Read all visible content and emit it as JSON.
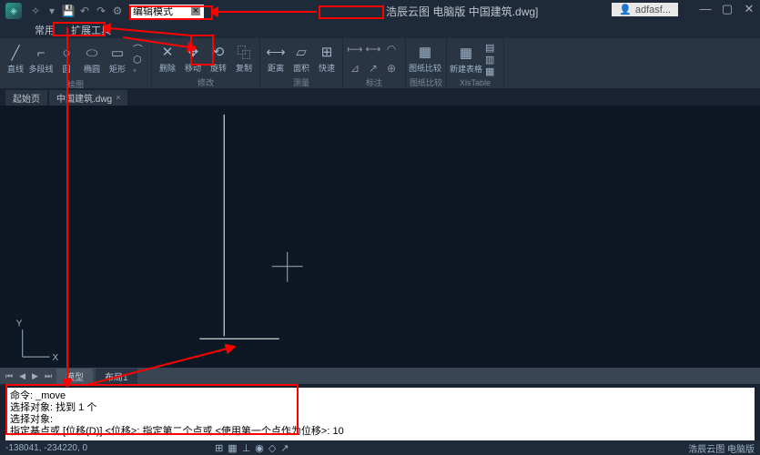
{
  "title": {
    "app": "浩辰云图 电脑版",
    "file": "中国建筑.dwg]"
  },
  "mode_box": "编辑模式",
  "user": "adfasf...",
  "menu": [
    "常用",
    "扩展工具"
  ],
  "ribbon": {
    "g1": {
      "label": "绘图",
      "btns": [
        {
          "name": "line",
          "lbl": "直线",
          "ico": "╱"
        },
        {
          "name": "polyline",
          "lbl": "多段线",
          "ico": "⌐"
        },
        {
          "name": "circle",
          "lbl": "圆",
          "ico": "○"
        },
        {
          "name": "ellipse",
          "lbl": "椭圆",
          "ico": "⬭"
        },
        {
          "name": "rect",
          "lbl": "矩形",
          "ico": "▭"
        }
      ]
    },
    "g2": {
      "label": "修改",
      "btns": [
        {
          "name": "delete",
          "lbl": "删除",
          "ico": "✕"
        },
        {
          "name": "move",
          "lbl": "移动",
          "ico": "✥"
        },
        {
          "name": "rotate",
          "lbl": "旋转",
          "ico": "⟲"
        },
        {
          "name": "copy",
          "lbl": "复制",
          "ico": "⿻"
        }
      ]
    },
    "g3": {
      "label": "测量",
      "btns": [
        {
          "name": "dist",
          "lbl": "距离",
          "ico": "⟷"
        },
        {
          "name": "area",
          "lbl": "面积",
          "ico": "▱"
        },
        {
          "name": "quick",
          "lbl": "快速",
          "ico": "⊞"
        }
      ]
    },
    "g4": {
      "label": "标注",
      "btns": [
        {
          "name": "dim1",
          "lbl": "",
          "ico": "⟼"
        },
        {
          "name": "dim2",
          "lbl": "",
          "ico": "⟷"
        },
        {
          "name": "dim3",
          "lbl": "",
          "ico": "◠"
        },
        {
          "name": "dim4",
          "lbl": "",
          "ico": "⊿"
        },
        {
          "name": "dim5",
          "lbl": "",
          "ico": "↗"
        },
        {
          "name": "dim6",
          "lbl": "",
          "ico": "⊕"
        }
      ]
    },
    "g5": {
      "label": "图纸比较",
      "btns": [
        {
          "name": "compare",
          "lbl": "图纸比较",
          "ico": "▦"
        }
      ]
    },
    "g6": {
      "label": "XlsTable",
      "btns": [
        {
          "name": "newtable",
          "lbl": "新建表格",
          "ico": "▦"
        }
      ]
    }
  },
  "doctabs": [
    {
      "label": "起始页"
    },
    {
      "label": "中国建筑.dwg"
    }
  ],
  "modeltabs": {
    "nav": [
      "⏮",
      "◀",
      "▶",
      "⏭"
    ],
    "tabs": [
      "模型",
      "布局1"
    ]
  },
  "cmd": {
    "l1": "命令: _move",
    "l2": "选择对象: 找到 1 个",
    "l3": "选择对象:",
    "l4": "指定基点或 [位移(D)] <位移>:   指定第二个点或 <使用第一个点作为位移>: 10"
  },
  "status": {
    "coords": "-138041, -234220, 0",
    "right": "浩辰云图 电脑版"
  },
  "ucs": {
    "x": "X",
    "y": "Y"
  }
}
